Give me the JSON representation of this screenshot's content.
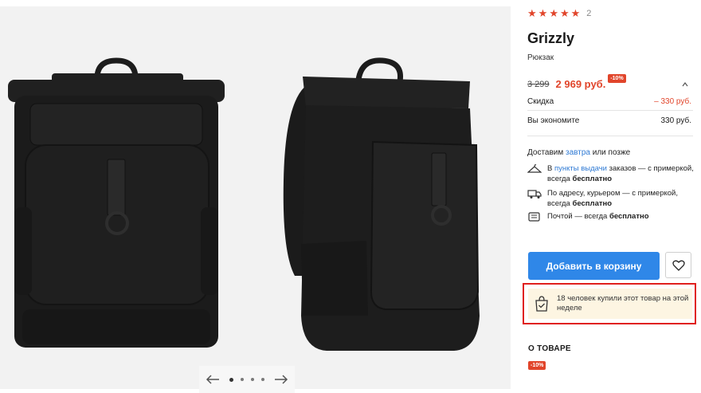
{
  "product": {
    "rating_stars": 5,
    "review_count": "2",
    "title": "Grizzly",
    "subtitle": "Рюкзак",
    "old_price": "3 299",
    "price": "2 969 руб.",
    "discount_badge": "-10%"
  },
  "price_breakdown": {
    "discount_label": "Скидка",
    "discount_value": "– 330 руб.",
    "save_label": "Вы экономите",
    "save_value": "330 руб."
  },
  "delivery": {
    "head_prefix": "Доставим ",
    "head_link": "завтра",
    "head_suffix": " или позже",
    "options": [
      {
        "icon": "hanger-icon",
        "prefix": "В ",
        "link": "пункты выдачи",
        "text": " заказов — с примеркой, всегда ",
        "bold": "бесплатно"
      },
      {
        "icon": "truck-icon",
        "prefix": "",
        "link": "",
        "text": "По адресу, курьером — с примеркой, всегда ",
        "bold": "бесплатно"
      },
      {
        "icon": "mail-icon",
        "prefix": "",
        "link": "",
        "text": "Почтой — всегда ",
        "bold": "бесплатно"
      }
    ]
  },
  "actions": {
    "add_to_cart": "Добавить в корзину",
    "favorite_icon": "heart-icon"
  },
  "promo": {
    "icon": "shopping-bag-check-icon",
    "text": "18 человек купили этот товар на этой неделе"
  },
  "about": {
    "heading": "О ТОВАРЕ",
    "badge": "-10%"
  },
  "gallery": {
    "dot_count": 4,
    "active_dot": 0,
    "colors": {
      "accent": "#e1452b",
      "button": "#2f87e8",
      "link": "#2f7ad4",
      "promo_bg": "#fdf5e2",
      "highlight": "#e0201e"
    }
  }
}
